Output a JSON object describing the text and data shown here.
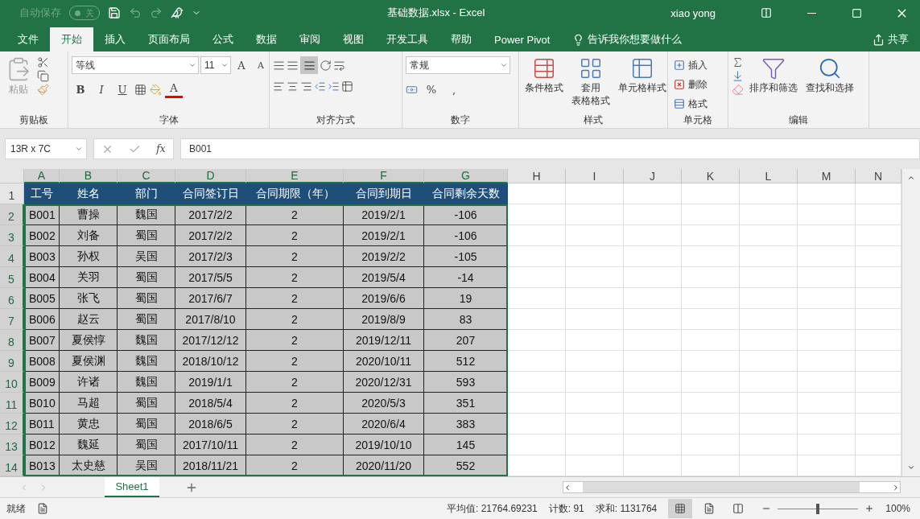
{
  "title_bar": {
    "autosave_label": "自动保存",
    "autosave": {
      "on": false,
      "text": "关"
    },
    "document_title": "基础数据.xlsx  -  Excel",
    "user": "xiao yong"
  },
  "ribbon_tabs": [
    {
      "label": "文件",
      "selected": false
    },
    {
      "label": "开始",
      "selected": true
    },
    {
      "label": "插入",
      "selected": false
    },
    {
      "label": "页面布局",
      "selected": false
    },
    {
      "label": "公式",
      "selected": false
    },
    {
      "label": "数据",
      "selected": false
    },
    {
      "label": "审阅",
      "selected": false
    },
    {
      "label": "视图",
      "selected": false
    },
    {
      "label": "开发工具",
      "selected": false
    },
    {
      "label": "帮助",
      "selected": false
    },
    {
      "label": "Power Pivot",
      "selected": false
    }
  ],
  "tell_me": "告诉我你想要做什么",
  "share": "共享",
  "ribbon": {
    "clipboard": {
      "paste": "粘贴",
      "label": "剪贴板"
    },
    "font": {
      "font_name": "等线",
      "font_size": "11",
      "grow": "A",
      "shrink": "A",
      "bold": "B",
      "italic": "I",
      "underline": "U",
      "font_color": "A",
      "label": "字体"
    },
    "alignment": {
      "label": "对齐方式"
    },
    "number": {
      "format": "常规",
      "percent": "%",
      "comma": ",",
      "label": "数字"
    },
    "styles": {
      "buttons": [
        {
          "lines": [
            "条件格式"
          ]
        },
        {
          "lines": [
            "套用",
            "表格格式"
          ]
        },
        {
          "lines": [
            "单元格样式"
          ]
        }
      ],
      "label": "样式"
    },
    "cells": {
      "items": [
        "插入",
        "删除",
        "格式"
      ],
      "label": "单元格"
    },
    "editing": {
      "buttons": [
        "排序和筛选",
        "查找和选择"
      ],
      "label": "编辑"
    }
  },
  "formula_bar": {
    "name_box": "13R x 7C",
    "fx": "fx",
    "value": "B001"
  },
  "sheet": {
    "columns": [
      {
        "label": "A",
        "selected": true
      },
      {
        "label": "B",
        "selected": true
      },
      {
        "label": "C",
        "selected": true
      },
      {
        "label": "D",
        "selected": true
      },
      {
        "label": "E",
        "selected": true
      },
      {
        "label": "F",
        "selected": true
      },
      {
        "label": "G",
        "selected": true
      },
      {
        "label": "H",
        "selected": false
      },
      {
        "label": "I",
        "selected": false
      },
      {
        "label": "J",
        "selected": false
      },
      {
        "label": "K",
        "selected": false
      },
      {
        "label": "L",
        "selected": false
      },
      {
        "label": "M",
        "selected": false
      },
      {
        "label": "N",
        "selected": false
      }
    ],
    "rows": [
      {
        "label": "1",
        "kind": "header",
        "selected": false,
        "cells": [
          "工号",
          "姓名",
          "部门",
          "合同签订日",
          "合同期限（年）",
          "合同到期日",
          "合同剩余天数"
        ]
      },
      {
        "label": "2",
        "kind": "data",
        "selected": true,
        "cells": [
          "B001",
          "曹操",
          "魏国",
          "2017/2/2",
          "2",
          "2019/2/1",
          "-106"
        ]
      },
      {
        "label": "3",
        "kind": "data",
        "selected": true,
        "cells": [
          "B002",
          "刘备",
          "蜀国",
          "2017/2/2",
          "2",
          "2019/2/1",
          "-106"
        ]
      },
      {
        "label": "4",
        "kind": "data",
        "selected": true,
        "cells": [
          "B003",
          "孙权",
          "吴国",
          "2017/2/3",
          "2",
          "2019/2/2",
          "-105"
        ]
      },
      {
        "label": "5",
        "kind": "data",
        "selected": true,
        "cells": [
          "B004",
          "关羽",
          "蜀国",
          "2017/5/5",
          "2",
          "2019/5/4",
          "-14"
        ]
      },
      {
        "label": "6",
        "kind": "data",
        "selected": true,
        "cells": [
          "B005",
          "张飞",
          "蜀国",
          "2017/6/7",
          "2",
          "2019/6/6",
          "19"
        ]
      },
      {
        "label": "7",
        "kind": "data",
        "selected": true,
        "cells": [
          "B006",
          "赵云",
          "蜀国",
          "2017/8/10",
          "2",
          "2019/8/9",
          "83"
        ]
      },
      {
        "label": "8",
        "kind": "data",
        "selected": true,
        "cells": [
          "B007",
          "夏侯惇",
          "魏国",
          "2017/12/12",
          "2",
          "2019/12/11",
          "207"
        ]
      },
      {
        "label": "9",
        "kind": "data",
        "selected": true,
        "cells": [
          "B008",
          "夏侯渊",
          "魏国",
          "2018/10/12",
          "2",
          "2020/10/11",
          "512"
        ]
      },
      {
        "label": "10",
        "kind": "data",
        "selected": true,
        "cells": [
          "B009",
          "许诸",
          "魏国",
          "2019/1/1",
          "2",
          "2020/12/31",
          "593"
        ]
      },
      {
        "label": "11",
        "kind": "data",
        "selected": true,
        "cells": [
          "B010",
          "马超",
          "蜀国",
          "2018/5/4",
          "2",
          "2020/5/3",
          "351"
        ]
      },
      {
        "label": "12",
        "kind": "data",
        "selected": true,
        "cells": [
          "B011",
          "黄忠",
          "蜀国",
          "2018/6/5",
          "2",
          "2020/6/4",
          "383"
        ]
      },
      {
        "label": "13",
        "kind": "data",
        "selected": true,
        "cells": [
          "B012",
          "魏延",
          "蜀国",
          "2017/10/11",
          "2",
          "2019/10/10",
          "145"
        ]
      },
      {
        "label": "14",
        "kind": "data",
        "selected": true,
        "cells": [
          "B013",
          "太史慈",
          "吴国",
          "2018/11/21",
          "2",
          "2020/11/20",
          "552"
        ]
      }
    ]
  },
  "sheet_tabs": [
    {
      "label": "Sheet1",
      "selected": true
    }
  ],
  "status_bar": {
    "mode": "就绪",
    "average": "平均值: 21764.69231",
    "count": "计数: 91",
    "sum": "求和: 1131764",
    "zoom": {
      "level": 0.5,
      "text": "100%"
    }
  }
}
